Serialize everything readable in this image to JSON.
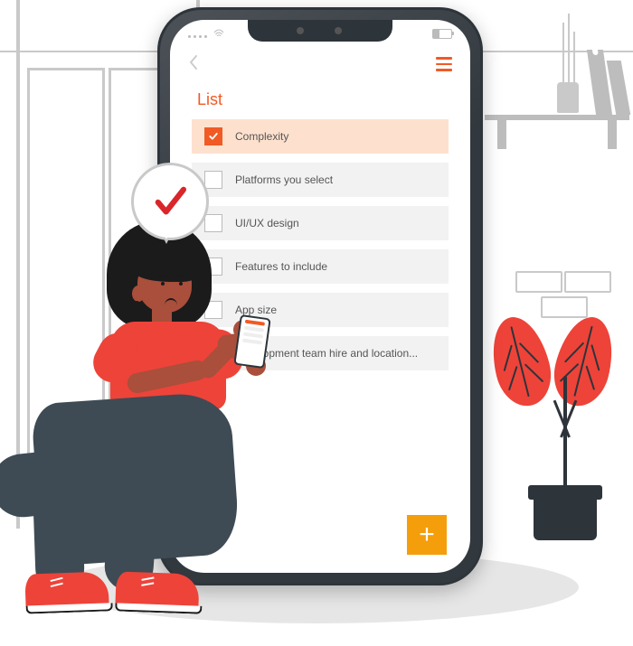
{
  "app": {
    "title": "List",
    "items": [
      {
        "label": "Complexity",
        "checked": true
      },
      {
        "label": "Platforms you select",
        "checked": false
      },
      {
        "label": "UI/UX design",
        "checked": false
      },
      {
        "label": "Features to include",
        "checked": false
      },
      {
        "label": "App size",
        "checked": false
      },
      {
        "label": "Development team hire and location...",
        "checked": false
      }
    ]
  },
  "colors": {
    "accent": "#f15a24",
    "leaf": "#ee4339",
    "dark": "#2d343a",
    "muted": "#c9c9c9"
  }
}
